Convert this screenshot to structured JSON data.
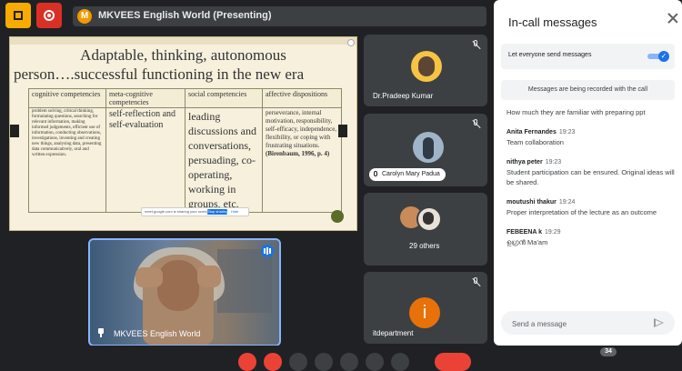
{
  "topbar": {
    "presenting_initial": "M",
    "presenting_label": "MKVEES English World (Presenting)"
  },
  "slide": {
    "title_line1": "Adaptable, thinking, autonomous",
    "title_line2": "person….successful functioning in the new era",
    "headers": [
      "cognitive competencies",
      "meta-cognitive competencies",
      "social competencies",
      "affective dispositions"
    ],
    "col1": "problem solving, critical thinking, formulating questions, searching for relevant information, making informed judgements, efficient use of information, conducting observations, investigations, inventing and creating new things, analysing data, presenting data communicatively, oral and written expression.",
    "col2": "self-reflection and self-evaluation",
    "col3": "leading discussions and conversations, persuading, co-operating, working in groups, etc.",
    "col4_text": "perseverance, internal motivation, responsibility, self-efficacy, independence, flexibility, or coping with frustrating situations.",
    "col4_cite": "(Birenbaum, 1996, p. 4)",
    "share_text": "meet.google.com is sharing your screen.",
    "stop_label": "Stop sharing",
    "hide_label": "Hide"
  },
  "main_video": {
    "name": "MKVEES English World"
  },
  "participants": [
    {
      "name": "Dr.Pradeep Kumar"
    },
    {
      "name": "Carolyn Mary Padua"
    },
    {
      "name": "29 others"
    },
    {
      "name": "itdepartment",
      "initial": "i"
    }
  ],
  "panel": {
    "title": "In-call messages",
    "let_everyone_label": "Let everyone send messages",
    "toggle_check": "✓",
    "recording_notice": "Messages are being recorded with the call",
    "messages": [
      {
        "author": "",
        "time": "",
        "text": "How much they are familiar with preparing ppt"
      },
      {
        "author": "Anita Fernandes",
        "time": "19:23",
        "text": "Team collaboration"
      },
      {
        "author": "nithya peter",
        "time": "19:23",
        "text": "Student participation can be ensured. Original ideas will be shared."
      },
      {
        "author": "moutushi thakur",
        "time": "19:24",
        "text": "Proper interpretation of the lecture as an outcome"
      },
      {
        "author": "FEBEENA k",
        "time": "19:29",
        "text": "ഉഗ്രൻ Ma'am"
      }
    ],
    "send_placeholder": "Send a message"
  },
  "bottom": {
    "participant_count": "34"
  },
  "colors": {
    "accent_blue": "#1a73e8",
    "bg_dark": "#202124",
    "tile_gray": "#3c4043",
    "end_call_red": "#ea4335"
  }
}
